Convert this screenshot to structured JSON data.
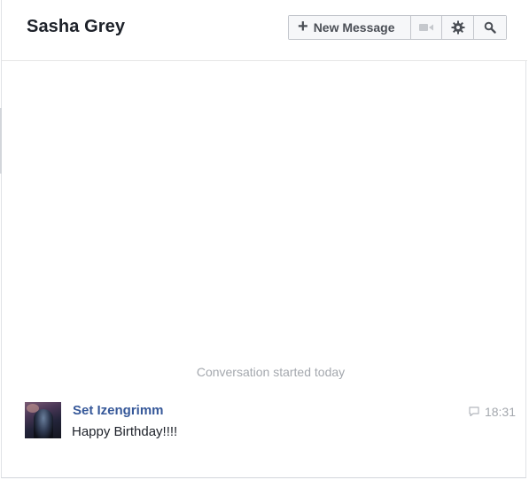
{
  "header": {
    "title": "Sasha Grey",
    "toolbar": {
      "new_message_label": "New Message",
      "new_message_icon": "plus-icon",
      "video_icon": "video-camera-icon",
      "settings_icon": "gear-icon",
      "search_icon": "search-icon"
    }
  },
  "conversation": {
    "started_text": "Conversation started today",
    "messages": [
      {
        "sender": "Set Izengrimm",
        "text": "Happy Birthday!!!!",
        "time": "18:31",
        "avatar_icon": "avatar",
        "status_icon": "message-bubble-icon"
      }
    ]
  },
  "colors": {
    "sender_link": "#365899",
    "muted": "#a4a8ae",
    "toolbar_border": "#c3c6cc"
  }
}
